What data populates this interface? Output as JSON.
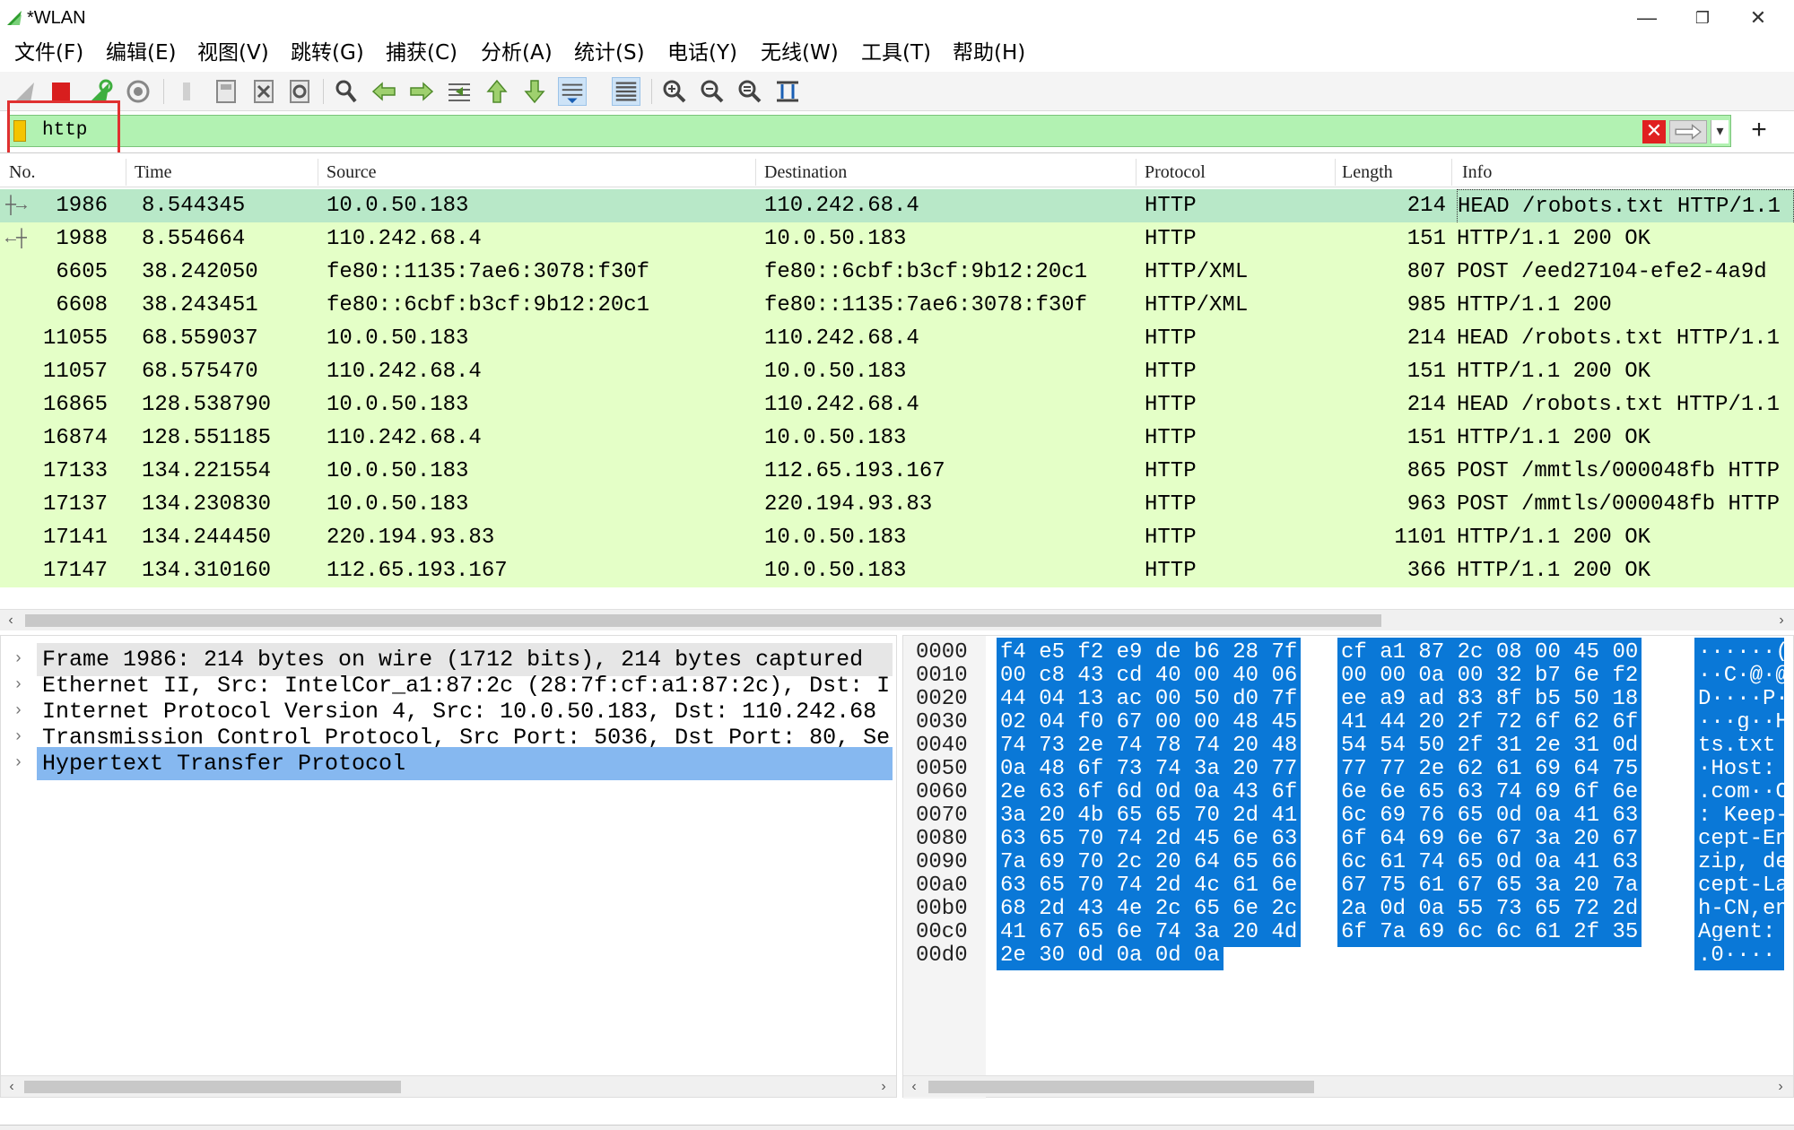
{
  "window": {
    "title": "*WLAN",
    "minimize": "—",
    "restore": "❐",
    "close": "✕"
  },
  "menu": [
    "文件(F)",
    "编辑(E)",
    "视图(V)",
    "跳转(G)",
    "捕获(C)",
    "分析(A)",
    "统计(S)",
    "电话(Y)",
    "无线(W)",
    "工具(T)",
    "帮助(H)"
  ],
  "toolbar": {
    "icons": [
      "shark-fin-start-icon",
      "stop-capture-icon",
      "restart-capture-icon",
      "capture-options-icon",
      "open-file-icon",
      "save-file-icon",
      "close-file-icon",
      "reload-file-icon",
      "find-packet-icon",
      "go-back-icon",
      "go-forward-icon",
      "go-to-packet-icon",
      "first-packet-icon",
      "last-packet-icon",
      "autoscroll-icon",
      "colorize-icon",
      "zoom-in-icon",
      "zoom-out-icon",
      "normal-size-icon",
      "resize-columns-icon"
    ]
  },
  "filter": {
    "value": "http",
    "clear_label": "✕",
    "add_label": "+"
  },
  "packet_list": {
    "columns": [
      "No.",
      "Time",
      "Source",
      "Destination",
      "Protocol",
      "Length",
      "Info"
    ],
    "rows": [
      {
        "no": "1986",
        "time": "8.544345",
        "src": "10.0.50.183",
        "dst": "110.242.68.4",
        "proto": "HTTP",
        "len": "214",
        "info": "HEAD /robots.txt HTTP/1.1",
        "selected": true
      },
      {
        "no": "1988",
        "time": "8.554664",
        "src": "110.242.68.4",
        "dst": "10.0.50.183",
        "proto": "HTTP",
        "len": "151",
        "info": "HTTP/1.1 200 OK"
      },
      {
        "no": "6605",
        "time": "38.242050",
        "src": "fe80::1135:7ae6:3078:f30f",
        "dst": "fe80::6cbf:b3cf:9b12:20c1",
        "proto": "HTTP/XML",
        "len": "807",
        "info": "POST /eed27104-efe2-4a9d"
      },
      {
        "no": "6608",
        "time": "38.243451",
        "src": "fe80::6cbf:b3cf:9b12:20c1",
        "dst": "fe80::1135:7ae6:3078:f30f",
        "proto": "HTTP/XML",
        "len": "985",
        "info": "HTTP/1.1 200"
      },
      {
        "no": "11055",
        "time": "68.559037",
        "src": "10.0.50.183",
        "dst": "110.242.68.4",
        "proto": "HTTP",
        "len": "214",
        "info": "HEAD /robots.txt HTTP/1.1"
      },
      {
        "no": "11057",
        "time": "68.575470",
        "src": "110.242.68.4",
        "dst": "10.0.50.183",
        "proto": "HTTP",
        "len": "151",
        "info": "HTTP/1.1 200 OK"
      },
      {
        "no": "16865",
        "time": "128.538790",
        "src": "10.0.50.183",
        "dst": "110.242.68.4",
        "proto": "HTTP",
        "len": "214",
        "info": "HEAD /robots.txt HTTP/1.1"
      },
      {
        "no": "16874",
        "time": "128.551185",
        "src": "110.242.68.4",
        "dst": "10.0.50.183",
        "proto": "HTTP",
        "len": "151",
        "info": "HTTP/1.1 200 OK"
      },
      {
        "no": "17133",
        "time": "134.221554",
        "src": "10.0.50.183",
        "dst": "112.65.193.167",
        "proto": "HTTP",
        "len": "865",
        "info": "POST /mmtls/000048fb HTTP"
      },
      {
        "no": "17137",
        "time": "134.230830",
        "src": "10.0.50.183",
        "dst": "220.194.93.83",
        "proto": "HTTP",
        "len": "963",
        "info": "POST /mmtls/000048fb HTTP"
      },
      {
        "no": "17141",
        "time": "134.244450",
        "src": "220.194.93.83",
        "dst": "10.0.50.183",
        "proto": "HTTP",
        "len": "1101",
        "info": "HTTP/1.1 200 OK"
      },
      {
        "no": "17147",
        "time": "134.310160",
        "src": "112.65.193.167",
        "dst": "10.0.50.183",
        "proto": "HTTP",
        "len": "366",
        "info": "HTTP/1.1 200 OK"
      }
    ]
  },
  "details": [
    {
      "text": "Frame 1986: 214 bytes on wire (1712 bits), 214 bytes captured",
      "state": "shaded"
    },
    {
      "text": "Ethernet II, Src: IntelCor_a1:87:2c (28:7f:cf:a1:87:2c), Dst: I",
      "state": ""
    },
    {
      "text": "Internet Protocol Version 4, Src: 10.0.50.183, Dst: 110.242.68",
      "state": ""
    },
    {
      "text": "Transmission Control Protocol, Src Port: 5036, Dst Port: 80, Se",
      "state": ""
    },
    {
      "text": "Hypertext Transfer Protocol",
      "state": "selected"
    }
  ],
  "bytes": [
    {
      "off": "0000",
      "h1": "f4 e5 f2 e9 de b6 28 7f",
      "h2": "cf a1 87 2c 08 00 45 00",
      "a": "······("
    },
    {
      "off": "0010",
      "h1": "00 c8 43 cd 40 00 40 06",
      "h2": "00 00 0a 00 32 b7 6e f2",
      "a": "··C·@·@"
    },
    {
      "off": "0020",
      "h1": "44 04 13 ac 00 50 d0 7f",
      "h2": "ee a9 ad 83 8f b5 50 18",
      "a": "D····P·"
    },
    {
      "off": "0030",
      "h1": "02 04 f0 67 00 00 48 45",
      "h2": "41 44 20 2f 72 6f 62 6f",
      "a": "···g··H"
    },
    {
      "off": "0040",
      "h1": "74 73 2e 74 78 74 20 48",
      "h2": "54 54 50 2f 31 2e 31 0d",
      "a": "ts.txt "
    },
    {
      "off": "0050",
      "h1": "0a 48 6f 73 74 3a 20 77",
      "h2": "77 77 2e 62 61 69 64 75",
      "a": "·Host: "
    },
    {
      "off": "0060",
      "h1": "2e 63 6f 6d 0d 0a 43 6f",
      "h2": "6e 6e 65 63 74 69 6f 6e",
      "a": ".com··C"
    },
    {
      "off": "0070",
      "h1": "3a 20 4b 65 65 70 2d 41",
      "h2": "6c 69 76 65 0d 0a 41 63",
      "a": ": Keep-"
    },
    {
      "off": "0080",
      "h1": "63 65 70 74 2d 45 6e 63",
      "h2": "6f 64 69 6e 67 3a 20 67",
      "a": "cept-En"
    },
    {
      "off": "0090",
      "h1": "7a 69 70 2c 20 64 65 66",
      "h2": "6c 61 74 65 0d 0a 41 63",
      "a": "zip, de"
    },
    {
      "off": "00a0",
      "h1": "63 65 70 74 2d 4c 61 6e",
      "h2": "67 75 61 67 65 3a 20 7a",
      "a": "cept-La"
    },
    {
      "off": "00b0",
      "h1": "68 2d 43 4e 2c 65 6e 2c",
      "h2": "2a 0d 0a 55 73 65 72 2d",
      "a": "h-CN,en"
    },
    {
      "off": "00c0",
      "h1": "41 67 65 6e 74 3a 20 4d",
      "h2": "6f 7a 69 6c 6c 61 2f 35",
      "a": "Agent: "
    },
    {
      "off": "00d0",
      "h1": "2e 30 0d 0a 0d 0a",
      "h2": "",
      "a": ".0····"
    }
  ],
  "colors": {
    "row_green": "#e4ffc7",
    "row_selected": "#b8e8c8",
    "filter_bg": "#b2f2b2",
    "byte_highlight": "#0a78d7",
    "detail_selected": "#86b8f0"
  }
}
